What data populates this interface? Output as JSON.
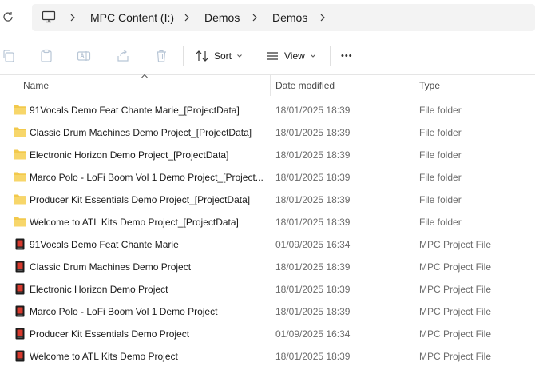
{
  "address": {
    "crumbs": [
      "MPC Content (I:)",
      "Demos",
      "Demos"
    ]
  },
  "toolbar": {
    "actions": [
      "copy-icon",
      "paste-icon",
      "rename-icon",
      "share-icon",
      "delete-icon"
    ],
    "sort_label": "Sort",
    "view_label": "View",
    "more_label": "•••"
  },
  "columns": {
    "name": "Name",
    "date": "Date modified",
    "type": "Type"
  },
  "files": [
    {
      "name": "91Vocals Demo Feat Chante Marie_[ProjectData]",
      "date": "18/01/2025 18:39",
      "type": "File folder",
      "icon": "folder-icon"
    },
    {
      "name": "Classic Drum Machines Demo Project_[ProjectData]",
      "date": "18/01/2025 18:39",
      "type": "File folder",
      "icon": "folder-icon"
    },
    {
      "name": "Electronic Horizon Demo Project_[ProjectData]",
      "date": "18/01/2025 18:39",
      "type": "File folder",
      "icon": "folder-icon"
    },
    {
      "name": "Marco Polo - LoFi Boom Vol 1 Demo Project_[Project...",
      "date": "18/01/2025 18:39",
      "type": "File folder",
      "icon": "folder-icon"
    },
    {
      "name": "Producer Kit Essentials Demo Project_[ProjectData]",
      "date": "18/01/2025 18:39",
      "type": "File folder",
      "icon": "folder-icon"
    },
    {
      "name": "Welcome to ATL Kits Demo Project_[ProjectData]",
      "date": "18/01/2025 18:39",
      "type": "File folder",
      "icon": "folder-icon"
    },
    {
      "name": "91Vocals Demo Feat Chante Marie",
      "date": "01/09/2025 16:34",
      "type": "MPC Project File",
      "icon": "mpc-file-icon"
    },
    {
      "name": "Classic Drum Machines Demo Project",
      "date": "18/01/2025 18:39",
      "type": "MPC Project File",
      "icon": "mpc-file-icon"
    },
    {
      "name": "Electronic Horizon Demo Project",
      "date": "18/01/2025 18:39",
      "type": "MPC Project File",
      "icon": "mpc-file-icon"
    },
    {
      "name": "Marco Polo - LoFi Boom Vol 1 Demo Project",
      "date": "18/01/2025 18:39",
      "type": "MPC Project File",
      "icon": "mpc-file-icon"
    },
    {
      "name": "Producer Kit Essentials Demo Project",
      "date": "01/09/2025 16:34",
      "type": "MPC Project File",
      "icon": "mpc-file-icon"
    },
    {
      "name": "Welcome to ATL Kits Demo Project",
      "date": "18/01/2025 18:39",
      "type": "MPC Project File",
      "icon": "mpc-file-icon"
    }
  ],
  "colors": {
    "folder": "#f2c94c",
    "mpc_file": "#1c1c1c",
    "mpc_accent": "#d83a2e"
  }
}
